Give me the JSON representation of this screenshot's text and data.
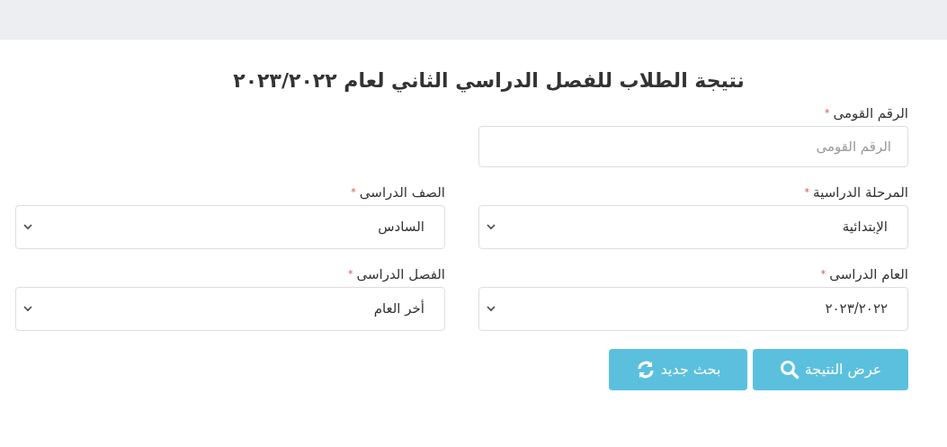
{
  "title": "نتيجة الطلاب للفصل الدراسي الثاني لعام ٢٠٢٣/٢٠٢٢",
  "rows": [
    [
      {
        "kind": "text",
        "label": "الرقم القومى",
        "required_mark": "*",
        "placeholder": "الرقم القومى"
      }
    ],
    [
      {
        "kind": "select",
        "label": "المرحلة الدراسية",
        "required_mark": "*",
        "value": "الإبتدائية"
      },
      {
        "kind": "select",
        "label": "الصف الدراسى",
        "required_mark": "*",
        "value": "السادس"
      }
    ],
    [
      {
        "kind": "select",
        "label": "العام الدراسى",
        "required_mark": "*",
        "value": "٢٠٢٣/٢٠٢٢"
      },
      {
        "kind": "select",
        "label": "الفصل الدراسى",
        "required_mark": "*",
        "value": "أخر العام"
      }
    ]
  ],
  "buttons": [
    {
      "label": "عرض النتيجة",
      "kind": "search"
    },
    {
      "label": "بحث جديد",
      "kind": "refresh"
    }
  ]
}
